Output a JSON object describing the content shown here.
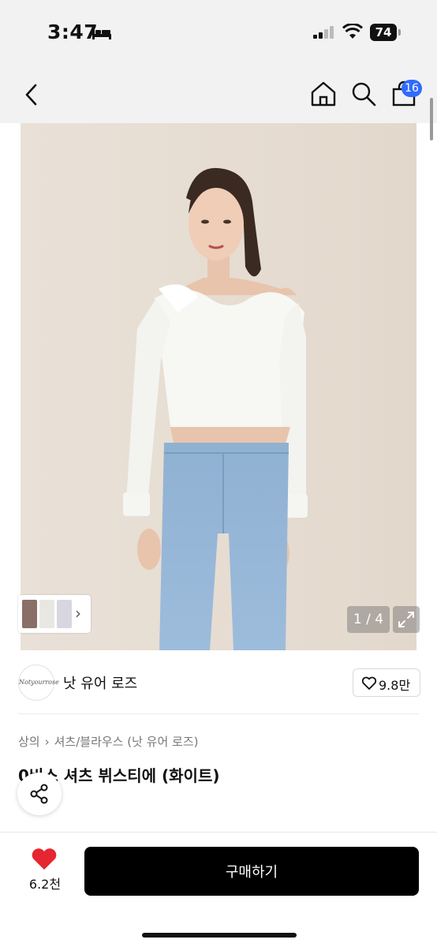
{
  "status_bar": {
    "time": "3:47",
    "battery": "74"
  },
  "nav": {
    "cart_count": "16"
  },
  "gallery": {
    "counter": "1 / 4"
  },
  "brand": {
    "logo_text": "Notyourrose",
    "name": "낫 유어 로즈",
    "likes": "9.8만"
  },
  "breadcrumb": [
    "상의",
    "셔츠/블라우스 (낫 유어 로즈)"
  ],
  "product": {
    "title": "0비스 셔츠 뷔스티에 (화이트)"
  },
  "bottom_bar": {
    "like_count": "6.2천",
    "buy_label": "구매하기"
  },
  "colors": {
    "accent": "#2f6bff",
    "heart": "#e5252f",
    "buy_bg": "#000000"
  }
}
